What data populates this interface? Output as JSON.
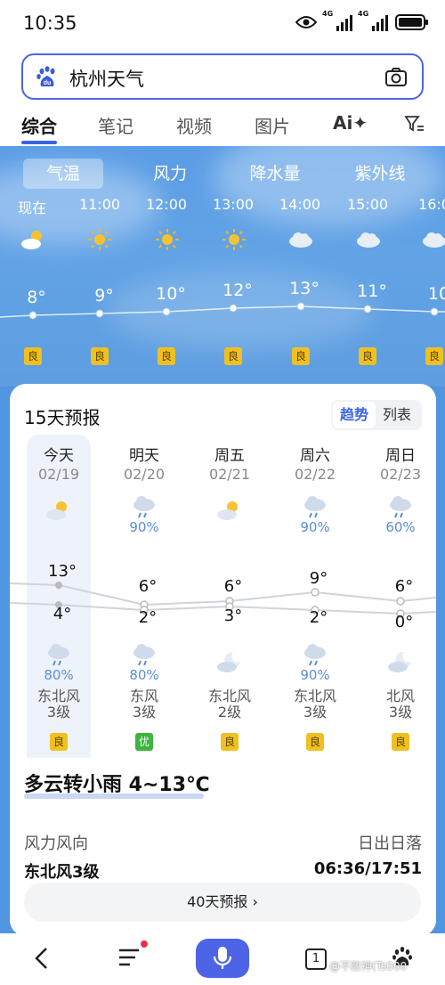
{
  "status": {
    "time": "10:35",
    "net1": "4G",
    "net2": "4G"
  },
  "search": {
    "query": "杭州天气"
  },
  "tabs": [
    "综合",
    "笔记",
    "视频",
    "图片",
    "Ai✦"
  ],
  "weather_tabs": [
    "气温",
    "风力",
    "降水量",
    "紫外线"
  ],
  "hourly": [
    {
      "time": "现在",
      "temp": "8°",
      "aqi": "良",
      "icon": "partly-cloudy-icon"
    },
    {
      "time": "11:00",
      "temp": "9°",
      "aqi": "良",
      "icon": "sun-icon"
    },
    {
      "time": "12:00",
      "temp": "10°",
      "aqi": "良",
      "icon": "sun-icon"
    },
    {
      "time": "13:00",
      "temp": "12°",
      "aqi": "良",
      "icon": "sun-icon"
    },
    {
      "time": "14:00",
      "temp": "13°",
      "aqi": "良",
      "icon": "cloud-icon"
    },
    {
      "time": "15:00",
      "temp": "11°",
      "aqi": "良",
      "icon": "cloud-icon"
    },
    {
      "time": "16:0",
      "temp": "10",
      "aqi": "良",
      "icon": "cloud-icon"
    }
  ],
  "forecast": {
    "title": "15天预报",
    "view_trend": "趋势",
    "view_list": "列表",
    "days": [
      {
        "name": "今天",
        "date": "02/19",
        "day_icon": "partly-cloudy-icon",
        "day_pct": "",
        "high": "13°",
        "low": "4°",
        "night_icon": "rain-cloud-icon",
        "night_pct": "80%",
        "wind": "东北风",
        "wind_level": "3级",
        "aqi": "良"
      },
      {
        "name": "明天",
        "date": "02/20",
        "day_icon": "rain-cloud-icon",
        "day_pct": "90%",
        "high": "6°",
        "low": "2°",
        "night_icon": "rain-cloud-icon",
        "night_pct": "80%",
        "wind": "东风",
        "wind_level": "3级",
        "aqi": "优"
      },
      {
        "name": "周五",
        "date": "02/21",
        "day_icon": "partly-cloudy-icon",
        "day_pct": "",
        "high": "6°",
        "low": "3°",
        "night_icon": "moon-cloud-icon",
        "night_pct": "",
        "wind": "东北风",
        "wind_level": "2级",
        "aqi": "良"
      },
      {
        "name": "周六",
        "date": "02/22",
        "day_icon": "rain-cloud-icon",
        "day_pct": "90%",
        "high": "9°",
        "low": "2°",
        "night_icon": "rain-cloud-icon",
        "night_pct": "90%",
        "wind": "东北风",
        "wind_level": "3级",
        "aqi": "良"
      },
      {
        "name": "周日",
        "date": "02/23",
        "day_icon": "rain-cloud-icon",
        "day_pct": "60%",
        "high": "6°",
        "low": "0°",
        "night_icon": "moon-cloud-icon",
        "night_pct": "",
        "wind": "北风",
        "wind_level": "3级",
        "aqi": "良"
      }
    ]
  },
  "today": {
    "summary": "多云转小雨 4~13℃",
    "wind_label": "风力风向",
    "wind_value": "东北风3级",
    "sun_label": "日出日落",
    "sun_value": "06:36/17:51",
    "forty_day": "40天预报 ›"
  },
  "bottom_nav": {
    "tab_count": "1"
  },
  "watermark": "@不败神(Ts000",
  "colors": {
    "accent": "#3a63e8",
    "aqi_good": "#f0c020",
    "aqi_excellent": "#3cb53c",
    "sky": "#5b9de6"
  }
}
